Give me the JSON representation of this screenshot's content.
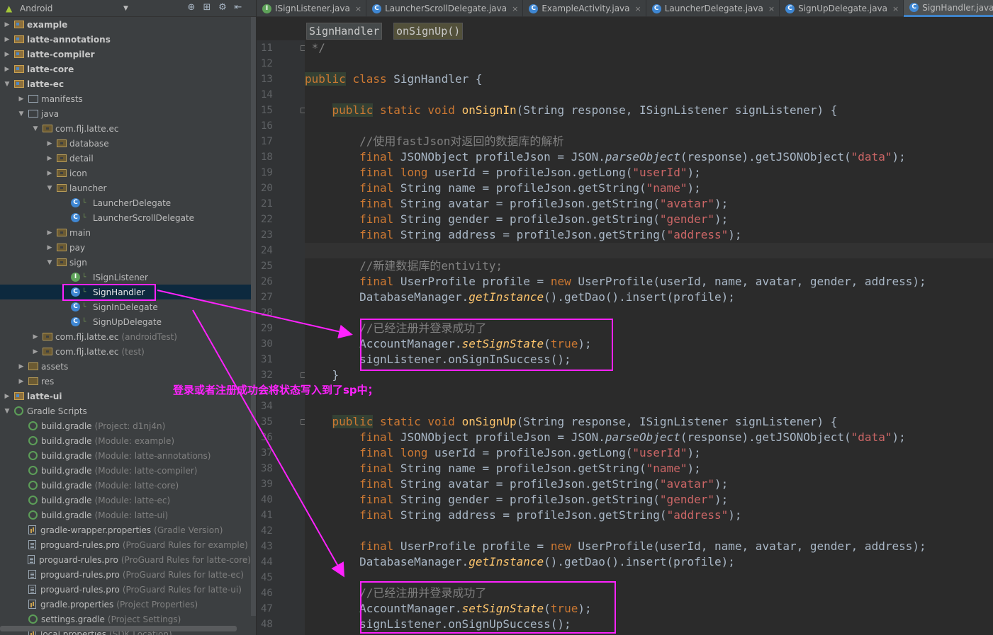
{
  "sidebar": {
    "view_label": "Android",
    "tree": [
      {
        "label": "example",
        "kind": "module",
        "arrow": "right",
        "bold": true,
        "hint": ""
      },
      {
        "label": "latte-annotations",
        "kind": "module",
        "arrow": "right",
        "bold": true,
        "hint": ""
      },
      {
        "label": "latte-compiler",
        "kind": "module",
        "arrow": "right",
        "bold": true,
        "hint": ""
      },
      {
        "label": "latte-core",
        "kind": "module",
        "arrow": "right",
        "bold": true,
        "hint": ""
      },
      {
        "label": "latte-ec",
        "kind": "module",
        "arrow": "down",
        "bold": true,
        "hint": ""
      },
      {
        "label": "manifests",
        "kind": "dir",
        "arrow": "right",
        "hint": ""
      },
      {
        "label": "java",
        "kind": "dir",
        "arrow": "down",
        "hint": ""
      },
      {
        "label": "com.flj.latte.ec",
        "kind": "pkg",
        "arrow": "down",
        "hint": ""
      },
      {
        "label": "database",
        "kind": "pkg",
        "arrow": "right",
        "hint": ""
      },
      {
        "label": "detail",
        "kind": "pkg",
        "arrow": "right",
        "hint": ""
      },
      {
        "label": "icon",
        "kind": "pkg",
        "arrow": "right",
        "hint": ""
      },
      {
        "label": "launcher",
        "kind": "pkg",
        "arrow": "down",
        "hint": ""
      },
      {
        "label": "LauncherDelegate",
        "kind": "class",
        "arrow": "none",
        "hint": ""
      },
      {
        "label": "LauncherScrollDelegate",
        "kind": "class",
        "arrow": "none",
        "hint": ""
      },
      {
        "label": "main",
        "kind": "pkg",
        "arrow": "right",
        "hint": ""
      },
      {
        "label": "pay",
        "kind": "pkg",
        "arrow": "right",
        "hint": ""
      },
      {
        "label": "sign",
        "kind": "pkg",
        "arrow": "down",
        "hint": ""
      },
      {
        "label": "ISignListener",
        "kind": "interface",
        "arrow": "none",
        "hint": ""
      },
      {
        "label": "SignHandler",
        "kind": "class",
        "arrow": "none",
        "hint": "",
        "selected": true
      },
      {
        "label": "SignInDelegate",
        "kind": "class",
        "arrow": "none",
        "hint": ""
      },
      {
        "label": "SignUpDelegate",
        "kind": "class",
        "arrow": "none",
        "hint": ""
      },
      {
        "label": "com.flj.latte.ec",
        "kind": "pkg",
        "arrow": "right",
        "hint": "(androidTest)"
      },
      {
        "label": "com.flj.latte.ec",
        "kind": "pkg",
        "arrow": "right",
        "hint": "(test)"
      },
      {
        "label": "assets",
        "kind": "res",
        "arrow": "right",
        "hint": ""
      },
      {
        "label": "res",
        "kind": "res",
        "arrow": "right",
        "hint": ""
      },
      {
        "label": "latte-ui",
        "kind": "module",
        "arrow": "right",
        "bold": true,
        "hint": ""
      },
      {
        "label": "Gradle Scripts",
        "kind": "gradle",
        "arrow": "down",
        "hint": ""
      },
      {
        "label": "build.gradle",
        "kind": "gradle",
        "arrow": "none",
        "hint": "(Project: d1nj4n)"
      },
      {
        "label": "build.gradle",
        "kind": "gradle",
        "arrow": "none",
        "hint": "(Module: example)"
      },
      {
        "label": "build.gradle",
        "kind": "gradle",
        "arrow": "none",
        "hint": "(Module: latte-annotations)"
      },
      {
        "label": "build.gradle",
        "kind": "gradle",
        "arrow": "none",
        "hint": "(Module: latte-compiler)"
      },
      {
        "label": "build.gradle",
        "kind": "gradle",
        "arrow": "none",
        "hint": "(Module: latte-core)"
      },
      {
        "label": "build.gradle",
        "kind": "gradle",
        "arrow": "none",
        "hint": "(Module: latte-ec)"
      },
      {
        "label": "build.gradle",
        "kind": "gradle",
        "arrow": "none",
        "hint": "(Module: latte-ui)"
      },
      {
        "label": "gradle-wrapper.properties",
        "kind": "propchart",
        "arrow": "none",
        "hint": "(Gradle Version)"
      },
      {
        "label": "proguard-rules.pro",
        "kind": "doc",
        "arrow": "none",
        "hint": "(ProGuard Rules for example)"
      },
      {
        "label": "proguard-rules.pro",
        "kind": "doc",
        "arrow": "none",
        "hint": "(ProGuard Rules for latte-core)"
      },
      {
        "label": "proguard-rules.pro",
        "kind": "doc",
        "arrow": "none",
        "hint": "(ProGuard Rules for latte-ec)"
      },
      {
        "label": "proguard-rules.pro",
        "kind": "doc",
        "arrow": "none",
        "hint": "(ProGuard Rules for latte-ui)"
      },
      {
        "label": "gradle.properties",
        "kind": "propchart",
        "arrow": "none",
        "hint": "(Project Properties)"
      },
      {
        "label": "settings.gradle",
        "kind": "gradle",
        "arrow": "none",
        "hint": "(Project Settings)"
      },
      {
        "label": "local.properties",
        "kind": "propchart",
        "arrow": "none",
        "hint": "(SDK Location)"
      }
    ]
  },
  "tabs": [
    {
      "label": "ISignListener.java",
      "icon": "interface-icon",
      "active": false
    },
    {
      "label": "LauncherScrollDelegate.java",
      "icon": "class-icon",
      "active": false
    },
    {
      "label": "ExampleActivity.java",
      "icon": "class-icon",
      "active": false
    },
    {
      "label": "LauncherDelegate.java",
      "icon": "class-icon",
      "active": false
    },
    {
      "label": "SignUpDelegate.java",
      "icon": "class-icon",
      "active": false
    },
    {
      "label": "SignHandler.java",
      "icon": "class-icon",
      "active": true
    }
  ],
  "breadcrumb": {
    "class_name": "SignHandler",
    "method_name": "onSignUp()"
  },
  "annotation": {
    "note": "登录或者注册成功会将状态写入到了sp中；",
    "color": "#ff00ff"
  },
  "code": [
    {
      "n": "11",
      "fold": true,
      "html": "<span class=\"cm\"> */</span>"
    },
    {
      "n": "12",
      "html": ""
    },
    {
      "n": "13",
      "html": "<span class=\"kwhl\">public</span> <span class=\"kw\">class</span> SignHandler {"
    },
    {
      "n": "14",
      "html": ""
    },
    {
      "n": "15",
      "fold": true,
      "html": "    <span class=\"kwhl\">public</span> <span class=\"kw\">static void</span> <span class=\"fn\">onSignIn</span>(String <span class=\"par\">response</span>, ISignListener <span class=\"par\">signListener</span>) {"
    },
    {
      "n": "16",
      "html": ""
    },
    {
      "n": "17",
      "html": "        <span class=\"cm\">//使用fastJson对返回的数据库的解析</span>"
    },
    {
      "n": "18",
      "html": "        <span class=\"kw\">final</span> JSONObject <span class=\"par\">profileJson</span> = JSON.<span class=\"itw\">parseObject</span>(response).getJSONObject(<span class=\"strr\">\"data\"</span>);"
    },
    {
      "n": "19",
      "html": "        <span class=\"kw\">final long</span> <span class=\"par\">userId</span> = profileJson.getLong(<span class=\"strr\">\"userId\"</span>);"
    },
    {
      "n": "20",
      "html": "        <span class=\"kw\">final</span> String <span class=\"par\">name</span> = profileJson.getString(<span class=\"strr\">\"name\"</span>);"
    },
    {
      "n": "21",
      "html": "        <span class=\"kw\">final</span> String <span class=\"par\">avatar</span> = profileJson.getString(<span class=\"strr\">\"avatar\"</span>);"
    },
    {
      "n": "22",
      "html": "        <span class=\"kw\">final</span> String <span class=\"par\">gender</span> = profileJson.getString(<span class=\"strr\">\"gender\"</span>);"
    },
    {
      "n": "23",
      "html": "        <span class=\"kw\">final</span> String <span class=\"par\">address</span> = profileJson.getString(<span class=\"strr\">\"address\"</span>);"
    },
    {
      "n": "24",
      "caret": true,
      "html": ""
    },
    {
      "n": "25",
      "html": "        <span class=\"cm\">//新建数据库的entivity;</span>"
    },
    {
      "n": "26",
      "html": "        <span class=\"kw\">final</span> UserProfile <span class=\"par\">profile</span> = <span class=\"kw\">new</span> UserProfile(userId, name, avatar, gender, address);"
    },
    {
      "n": "27",
      "html": "        DatabaseManager.<span class=\"it\">getInstance</span>().getDao().insert(profile);"
    },
    {
      "n": "28",
      "html": ""
    },
    {
      "n": "29",
      "html": "        <span class=\"cm\">//已经注册并登录成功了</span>"
    },
    {
      "n": "30",
      "html": "        AccountManager.<span class=\"it\">setSignState</span>(<span class=\"kw\">true</span>);"
    },
    {
      "n": "31",
      "html": "        signListener.onSignInSuccess();"
    },
    {
      "n": "32",
      "fold": true,
      "html": "    }"
    },
    {
      "n": "33",
      "html": ""
    },
    {
      "n": "34",
      "html": ""
    },
    {
      "n": "35",
      "fold": true,
      "html": "    <span class=\"kwhl\">public</span> <span class=\"kw\">static void</span> <span class=\"fn\">onSignUp</span>(String <span class=\"par\">response</span>, ISignListener <span class=\"par\">signListener</span>) {"
    },
    {
      "n": "36",
      "html": "        <span class=\"kw\">final</span> JSONObject <span class=\"par\">profileJson</span> = JSON.<span class=\"itw\">parseObject</span>(response).getJSONObject(<span class=\"strr\">\"data\"</span>);"
    },
    {
      "n": "37",
      "html": "        <span class=\"kw\">final long</span> <span class=\"par\">userId</span> = profileJson.getLong(<span class=\"strr\">\"userId\"</span>);"
    },
    {
      "n": "38",
      "html": "        <span class=\"kw\">final</span> String <span class=\"par\">name</span> = profileJson.getString(<span class=\"strr\">\"name\"</span>);"
    },
    {
      "n": "39",
      "html": "        <span class=\"kw\">final</span> String <span class=\"par\">avatar</span> = profileJson.getString(<span class=\"strr\">\"avatar\"</span>);"
    },
    {
      "n": "40",
      "html": "        <span class=\"kw\">final</span> String <span class=\"par\">gender</span> = profileJson.getString(<span class=\"strr\">\"gender\"</span>);"
    },
    {
      "n": "41",
      "html": "        <span class=\"kw\">final</span> String <span class=\"par\">address</span> = profileJson.getString(<span class=\"strr\">\"address\"</span>);"
    },
    {
      "n": "42",
      "html": ""
    },
    {
      "n": "43",
      "html": "        <span class=\"kw\">final</span> UserProfile <span class=\"par\">profile</span> = <span class=\"kw\">new</span> UserProfile(userId, name, avatar, gender, address);"
    },
    {
      "n": "44",
      "html": "        DatabaseManager.<span class=\"it\">getInstance</span>().getDao().insert(profile);"
    },
    {
      "n": "45",
      "html": ""
    },
    {
      "n": "46",
      "html": "        <span class=\"cm\">//已经注册并登录成功了</span>"
    },
    {
      "n": "47",
      "html": "        AccountManager.<span class=\"it\">setSignState</span>(<span class=\"kw\">true</span>);"
    },
    {
      "n": "48",
      "html": "        signListener.onSignUpSuccess();"
    }
  ]
}
